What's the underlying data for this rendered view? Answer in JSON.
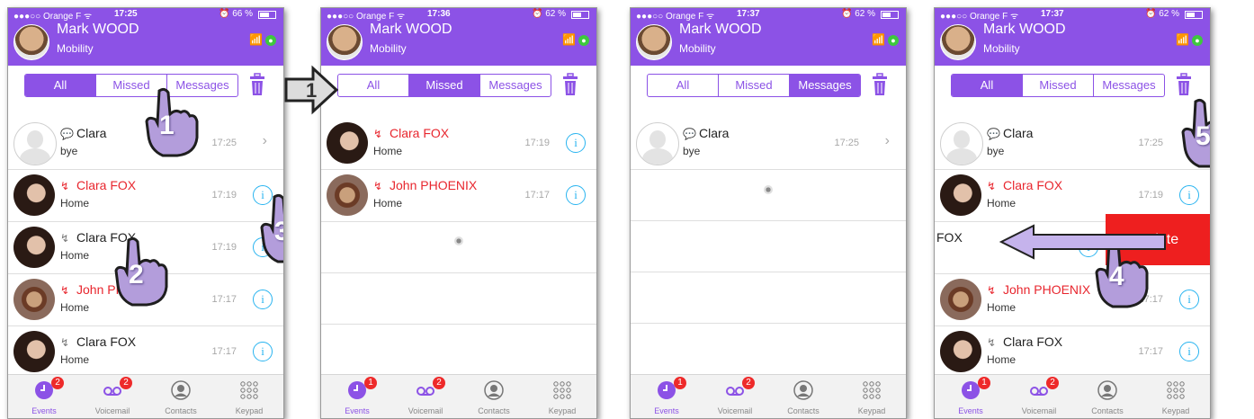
{
  "colors": {
    "accent": "#8c52e6",
    "missed": "#e8262e",
    "info": "#29b4f0",
    "delete": "#ee1f1f"
  },
  "screens": [
    {
      "status": {
        "carrier": "●●●○○ Orange F ᯤ",
        "time": "17:25",
        "battery": "⏰ 66 %"
      },
      "user": {
        "name": "Mark WOOD",
        "sub": "Mobility"
      },
      "tabs": [
        "All",
        "Missed",
        "Messages"
      ],
      "rows": [
        {
          "name": "Clara",
          "sub": "bye",
          "time": "17:25",
          "type": "chat-blue",
          "pic": "placeholder",
          "color": "normal",
          "action": "chevron"
        },
        {
          "name": "Clara FOX",
          "sub": "Home",
          "time": "17:19",
          "type": "miss",
          "pic": "woman",
          "color": "missed",
          "action": "info"
        },
        {
          "name": "Clara FOX",
          "sub": "Home",
          "time": "17:19",
          "type": "grey",
          "pic": "woman",
          "color": "normal",
          "action": "info"
        },
        {
          "name": "John PHOENIX",
          "sub": "Home",
          "time": "17:17",
          "type": "miss",
          "pic": "man",
          "color": "missed",
          "action": "info"
        },
        {
          "name": "Clara FOX",
          "sub": "Home",
          "time": "17:17",
          "type": "grey",
          "pic": "woman",
          "color": "normal",
          "action": "info"
        }
      ],
      "tabbar": {
        "events": "Events",
        "voicemail": "Voicemail",
        "contacts": "Contacts",
        "keypad": "Keypad",
        "events_badge": "2",
        "voicemail_badge": "2"
      },
      "hands": [
        "1",
        "2",
        "3"
      ]
    },
    {
      "status": {
        "carrier": "●●●○○ Orange F ᯤ",
        "time": "17:36",
        "battery": "⏰ 62 %"
      },
      "user": {
        "name": "Mark WOOD",
        "sub": "Mobility"
      },
      "tabs": [
        "All",
        "Missed",
        "Messages"
      ],
      "rows": [
        {
          "name": "Clara FOX",
          "sub": "Home",
          "time": "17:19",
          "type": "miss",
          "pic": "woman",
          "color": "missed",
          "action": "info"
        },
        {
          "name": "John PHOENIX",
          "sub": "Home",
          "time": "17:17",
          "type": "miss",
          "pic": "man",
          "color": "missed",
          "action": "info"
        }
      ],
      "tabbar": {
        "events": "Events",
        "voicemail": "Voicemail",
        "contacts": "Contacts",
        "keypad": "Keypad",
        "events_badge": "1",
        "voicemail_badge": "2"
      },
      "arrow_label": "1"
    },
    {
      "status": {
        "carrier": "●●●○○ Orange F ᯤ",
        "time": "17:37",
        "battery": "⏰ 62 %"
      },
      "user": {
        "name": "Mark WOOD",
        "sub": "Mobility"
      },
      "tabs": [
        "All",
        "Missed",
        "Messages"
      ],
      "rows": [
        {
          "name": "Clara",
          "sub": "bye",
          "time": "17:25",
          "type": "chat-grey",
          "pic": "placeholder",
          "color": "normal",
          "action": "chevron"
        }
      ],
      "tabbar": {
        "events": "Events",
        "voicemail": "Voicemail",
        "contacts": "Contacts",
        "keypad": "Keypad",
        "events_badge": "1",
        "voicemail_badge": "2"
      }
    },
    {
      "status": {
        "carrier": "●●●○○ Orange F ᯤ",
        "time": "17:37",
        "battery": "⏰ 62 %"
      },
      "user": {
        "name": "Mark WOOD",
        "sub": "Mobility"
      },
      "tabs": [
        "All",
        "Missed",
        "Messages"
      ],
      "rows": [
        {
          "name": "Clara",
          "sub": "bye",
          "time": "17:25",
          "type": "chat-grey",
          "pic": "placeholder",
          "color": "normal",
          "action": "none"
        },
        {
          "name": "Clara FOX",
          "sub": "Home",
          "time": "17:19",
          "type": "miss",
          "pic": "woman",
          "color": "missed",
          "action": "info"
        },
        {
          "name": "FOX",
          "sub": "",
          "time": "17:19",
          "type": "none",
          "pic": "none",
          "color": "normal",
          "action": "info"
        },
        {
          "name": "John PHOENIX",
          "sub": "Home",
          "time": "17:17",
          "type": "miss",
          "pic": "man",
          "color": "missed",
          "action": "info"
        },
        {
          "name": "Clara FOX",
          "sub": "Home",
          "time": "17:17",
          "type": "grey",
          "pic": "woman",
          "color": "normal",
          "action": "info"
        }
      ],
      "delete_label": "Delete",
      "tabbar": {
        "events": "Events",
        "voicemail": "Voicemail",
        "contacts": "Contacts",
        "keypad": "Keypad",
        "events_badge": "1",
        "voicemail_badge": "2"
      },
      "hands": [
        "4",
        "5"
      ]
    }
  ]
}
